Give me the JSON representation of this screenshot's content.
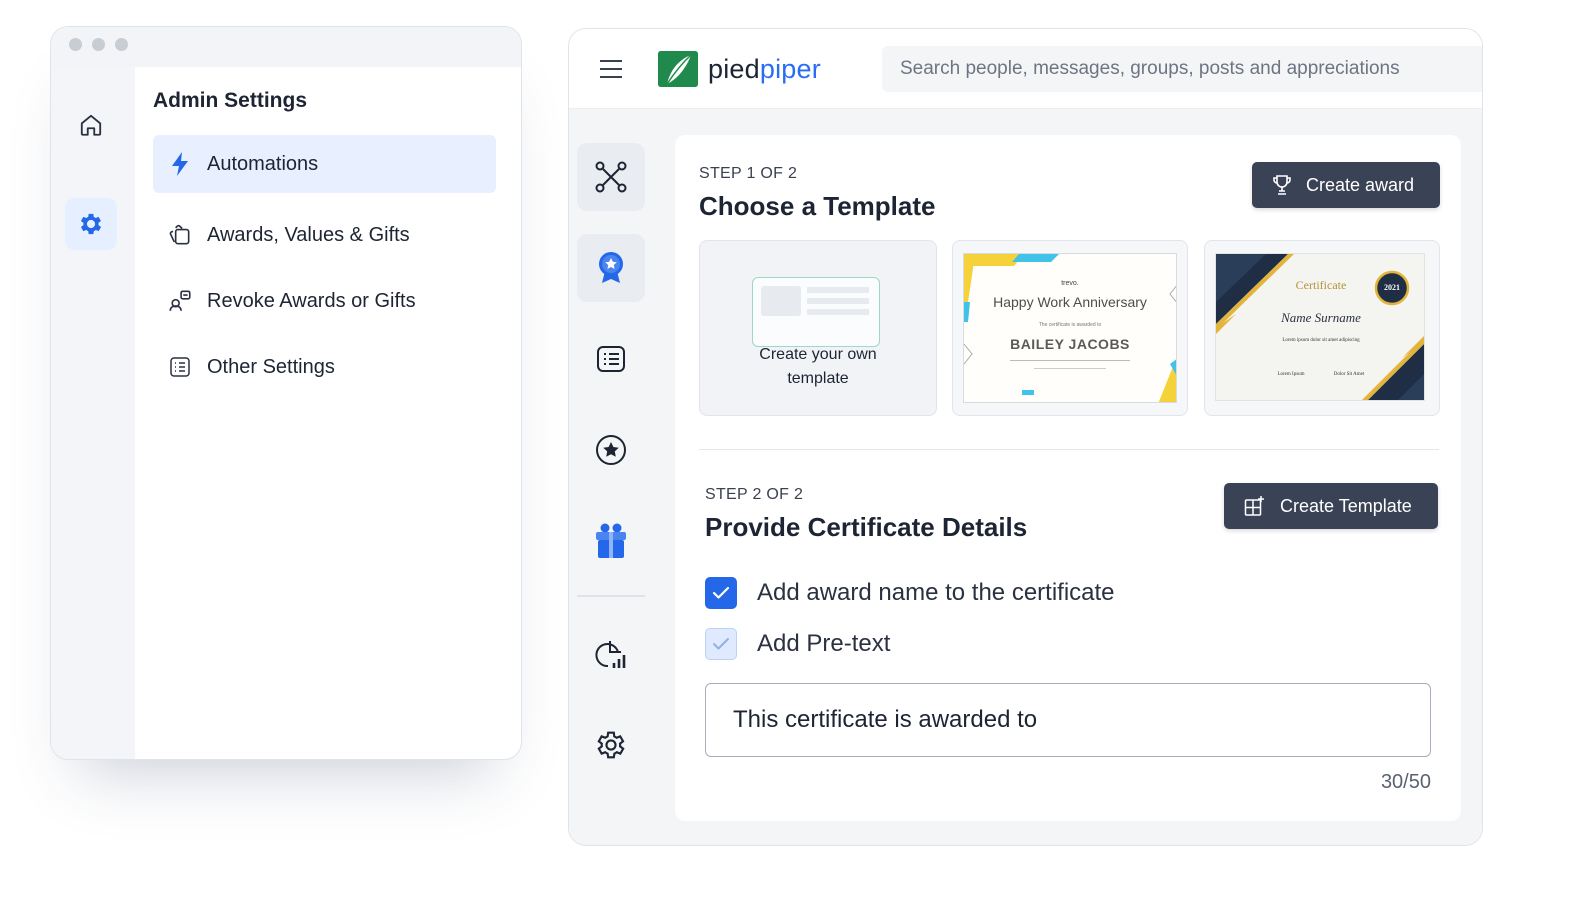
{
  "admin": {
    "title": "Admin Settings",
    "menu": [
      {
        "label": "Automations",
        "icon": "lightning-icon",
        "active": true
      },
      {
        "label": "Awards, Values & Gifts",
        "icon": "gifts-stack-icon"
      },
      {
        "label": "Revoke Awards or Gifts",
        "icon": "revoke-icon"
      },
      {
        "label": "Other Settings",
        "icon": "list-settings-icon"
      }
    ],
    "rail": [
      {
        "icon": "home-icon"
      },
      {
        "icon": "gear-icon",
        "active": true
      }
    ]
  },
  "app": {
    "brand": {
      "part1": "pied",
      "part2": "piper"
    },
    "search_placeholder": "Search people, messages, groups, posts and appreciations",
    "sidebar": [
      {
        "icon": "workflow-icon"
      },
      {
        "icon": "award-ribbon-icon"
      },
      {
        "icon": "list-card-icon"
      },
      {
        "icon": "star-circle-icon"
      },
      {
        "icon": "gift-icon"
      },
      {
        "icon": "analytics-icon"
      },
      {
        "icon": "settings-icon"
      }
    ]
  },
  "step1": {
    "label": "STEP 1 OF 2",
    "title": "Choose a Template",
    "button": "Create award",
    "templates": {
      "own_line1": "Create your own",
      "own_line2": "template",
      "cert1": {
        "brand": "trevo.",
        "title": "Happy Work Anniversary",
        "subtitle": "The certificate is awarded to",
        "name": "BAILEY JACOBS"
      },
      "cert2": {
        "title": "Certificate",
        "name": "Name Surname",
        "body": "Lorem ipsum dolor sit amet adipiscing",
        "badge": "2021",
        "sig1": "Lorem Ipsum",
        "sig2": "Dolor Sit Amet"
      }
    }
  },
  "step2": {
    "label": "STEP 2 OF 2",
    "title": "Provide Certificate Details",
    "button": "Create Template",
    "opt_award_name": "Add award name to the certificate",
    "opt_pretext": "Add Pre-text",
    "pretext_value": "This certificate is awarded to",
    "counter": "30/50"
  },
  "colors": {
    "accent": "#2467e8",
    "dark_button": "#3a4356",
    "brand_green": "#1f8a4c",
    "brand_blue": "#2a6df5"
  }
}
